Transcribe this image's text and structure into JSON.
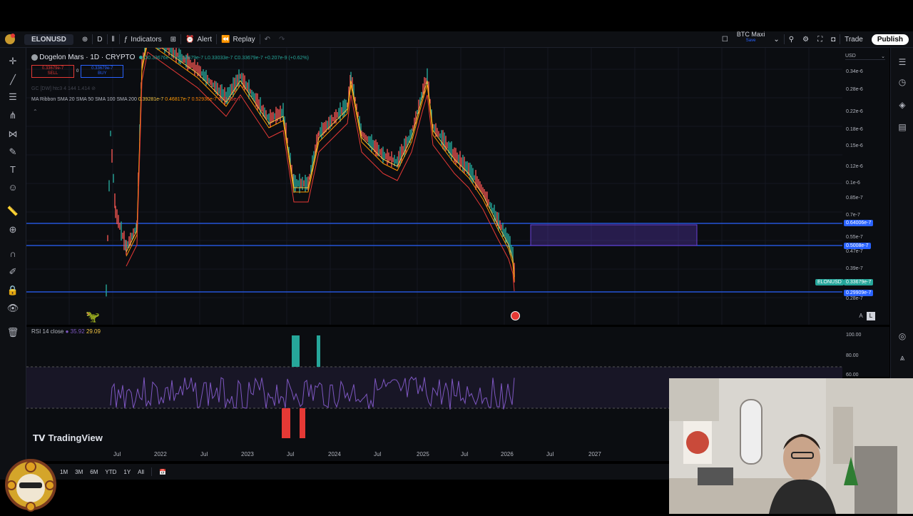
{
  "toolbar": {
    "symbol": "ELONUSD",
    "interval": "D",
    "indicators": "Indicators",
    "alert": "Alert",
    "replay": "Replay",
    "layout_name": "BTC Maxi",
    "layout_sub": "Save",
    "trade": "Trade",
    "publish": "Publish"
  },
  "legend": {
    "title": "Dogelon Mars · 1D · CRYPTO",
    "ohlc": "O0.33676e-7  H0.33679e-7  L0.33033e-7  C0.33679e-7  +0.207e-9 (+0.62%)",
    "sell_price": "0.33679e-7",
    "sell_label": "SELL",
    "spread": "0",
    "buy_price": "0.33679e-7",
    "buy_label": "BUY",
    "indicator1": "GC [DW] htc3 4 144 1.414",
    "ma_ribbon": "MA Ribbon SMA 20 SMA 50 SMA 100 SMA 200",
    "ma_v1": "0.39281e-7",
    "ma_v2": "0.46817e-7",
    "ma_v3": "0.52936e-7",
    "ma_v4": "0.6135e-7",
    "rsi_label": "RSI 14 close",
    "rsi_v1": "35.92",
    "rsi_v2": "29.09"
  },
  "price_axis": {
    "currency": "USD",
    "ticks": [
      "0.34e-6",
      "0.28e-6",
      "0.22e-6",
      "0.18e-6",
      "0.15e-6",
      "0.12e-6",
      "0.1e-6",
      "0.85e-7",
      "0.7e-7",
      "0.55e-7",
      "0.47e-7",
      "0.39e-7",
      "0.28e-7"
    ],
    "badge_upper": "0.64006e-7",
    "badge_mid": "0.5008e-7",
    "badge_symbol": "ELONUSD",
    "badge_current": "0.33679e-7",
    "badge_lower": "0.29909e-7",
    "auto": "A",
    "log": "L"
  },
  "rsi_axis": {
    "ticks": [
      "100.00",
      "80.00",
      "60.00"
    ]
  },
  "time_axis": {
    "labels": [
      "Jul",
      "2022",
      "Jul",
      "2023",
      "Jul",
      "2024",
      "Jul",
      "2025",
      "Jul",
      "2026",
      "Jul",
      "2027"
    ]
  },
  "bottom": {
    "ranges": [
      "1M",
      "3M",
      "6M",
      "YTD",
      "1Y",
      "All"
    ]
  },
  "brand": {
    "tradingview": "TradingView"
  },
  "colors": {
    "background": "#0b0d11",
    "hline": "#2962ff",
    "zone": "#6a3fd6",
    "sma20": "#f5c542",
    "sma50": "#ff9800",
    "sma100": "#e53935",
    "rsi_line": "#7e57c2",
    "green_badge": "#26a69a"
  }
}
